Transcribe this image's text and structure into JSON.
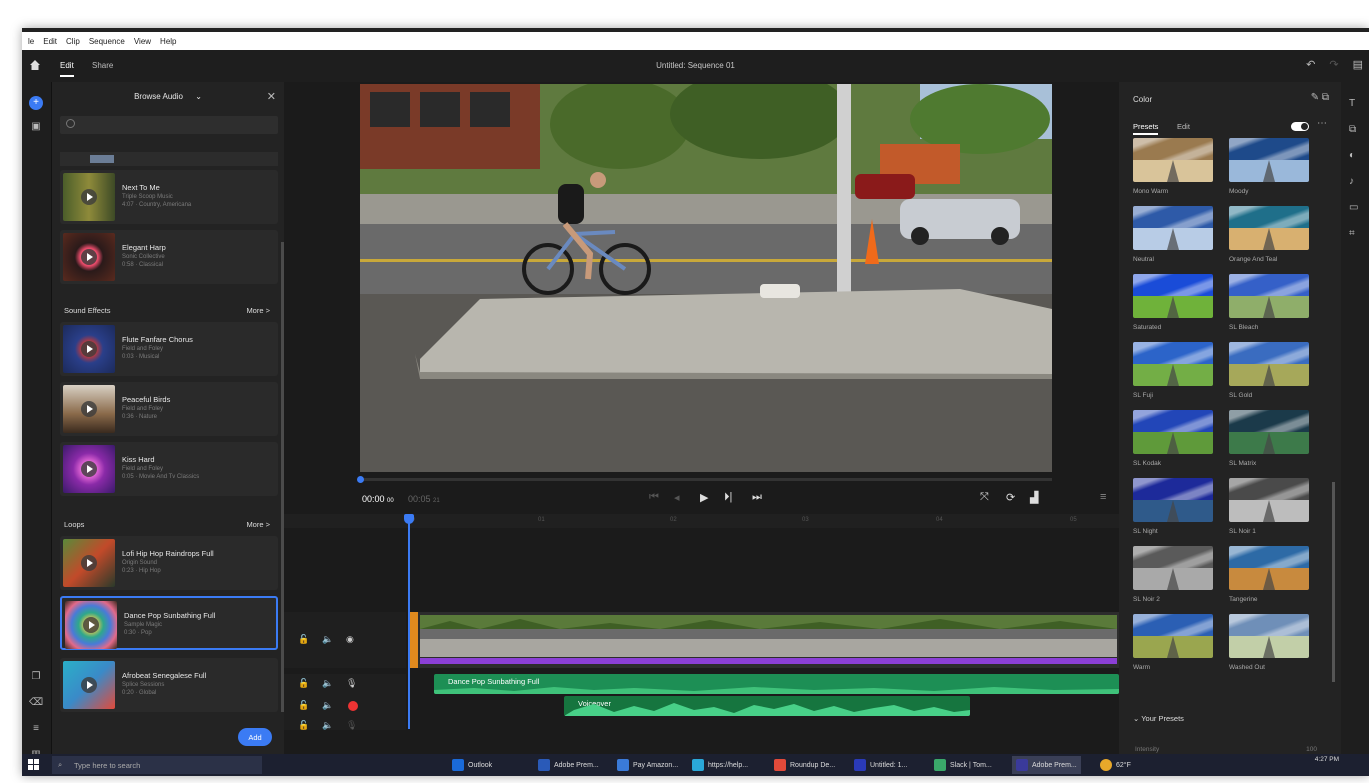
{
  "menubar": {
    "items": [
      "le",
      "Edit",
      "Clip",
      "Sequence",
      "View",
      "Help"
    ]
  },
  "topbar": {
    "tabs": [
      "Edit",
      "Share"
    ],
    "sequence_title": "Untitled: Sequence 01"
  },
  "left_panel": {
    "title": "Browse Audio",
    "search_placeholder": "",
    "music": [
      {
        "title": "Next To Me",
        "artist": "Triple Scoop Music",
        "meta": "4:07 · Country, Americana"
      },
      {
        "title": "Elegant Harp",
        "artist": "Sonic Collective",
        "meta": "0:58 · Classical"
      }
    ],
    "sound_effects_label": "Sound Effects",
    "more_label": "More >",
    "sound_effects": [
      {
        "title": "Flute Fanfare Chorus",
        "artist": "Field and Foley",
        "meta": "0:03 · Musical"
      },
      {
        "title": "Peaceful Birds",
        "artist": "Field and Foley",
        "meta": "0:36 · Nature"
      },
      {
        "title": "Kiss Hard",
        "artist": "Field and Foley",
        "meta": "0:05 · Movie And Tv Classics"
      }
    ],
    "loops_label": "Loops",
    "loops": [
      {
        "title": "Lofi Hip Hop Raindrops Full",
        "artist": "Origin Sound",
        "meta": "0:23 · Hip Hop"
      },
      {
        "title": "Dance Pop Sunbathing Full",
        "artist": "Sample Magic",
        "meta": "0:30 · Pop"
      },
      {
        "title": "Afrobeat Senegalese Full",
        "artist": "Splice Sessions",
        "meta": "0:20 · Global"
      }
    ],
    "add_label": "Add"
  },
  "player": {
    "current_time": "00:00",
    "current_frames": "00",
    "duration": "00:05",
    "duration_frames": "21"
  },
  "timeline": {
    "ruler_ticks": [
      "00",
      "01",
      "02",
      "03",
      "04",
      "05"
    ],
    "audio_clip_1": "Dance Pop Sunbathing Full",
    "audio_clip_2": "Voiceover"
  },
  "color_panel": {
    "title": "Color",
    "tabs": [
      "Presets",
      "Edit"
    ],
    "presets": [
      {
        "label": "Mono Warm",
        "colors": [
          "#9a7a4f",
          "#d9c49a"
        ]
      },
      {
        "label": "Moody",
        "colors": [
          "#1e4a8a",
          "#9ab8da"
        ]
      },
      {
        "label": "Neutral",
        "colors": [
          "#2e5aa8",
          "#b8cce6"
        ]
      },
      {
        "label": "Orange And Teal",
        "colors": [
          "#1f6f8a",
          "#d8b070"
        ]
      },
      {
        "label": "Saturated",
        "colors": [
          "#1a4cd8",
          "#6fb23a"
        ]
      },
      {
        "label": "SL Bleach",
        "colors": [
          "#3560c8",
          "#8fae6a"
        ]
      },
      {
        "label": "SL Fuji",
        "colors": [
          "#2c64c9",
          "#73ae46"
        ]
      },
      {
        "label": "SL Gold",
        "colors": [
          "#3a6cc0",
          "#a6a85a"
        ]
      },
      {
        "label": "SL Kodak",
        "colors": [
          "#2246b8",
          "#5f9a3a"
        ]
      },
      {
        "label": "SL Matrix",
        "colors": [
          "#1b3a4a",
          "#3d7a4a"
        ]
      },
      {
        "label": "SL Night",
        "colors": [
          "#1d2a9a",
          "#2f5a8a"
        ]
      },
      {
        "label": "SL Noir 1",
        "colors": [
          "#4a4a4a",
          "#bdbdbd"
        ]
      },
      {
        "label": "SL Noir 2",
        "colors": [
          "#5a5a5a",
          "#a9a9a9"
        ]
      },
      {
        "label": "Tangerine",
        "colors": [
          "#2d6aa6",
          "#c88a3e"
        ]
      },
      {
        "label": "Warm",
        "colors": [
          "#2b5fb4",
          "#9aa64f"
        ]
      },
      {
        "label": "Washed Out",
        "colors": [
          "#6f8fb8",
          "#c2cfa8"
        ]
      }
    ],
    "your_presets_label": "Your Presets",
    "intensity_label": "Intensity",
    "intensity_value": "100"
  },
  "taskbar": {
    "search_placeholder": "Type here to search",
    "apps": [
      "Outlook",
      "Adobe Prem...",
      "Pay Amazon...",
      "https://help...",
      "Roundup De...",
      "Untitled: 1...",
      "Slack | Tom...",
      "Adobe Prem..."
    ],
    "weather": "62°F",
    "time": "4:27 PM"
  },
  "accent_color": "#3b7bf4"
}
